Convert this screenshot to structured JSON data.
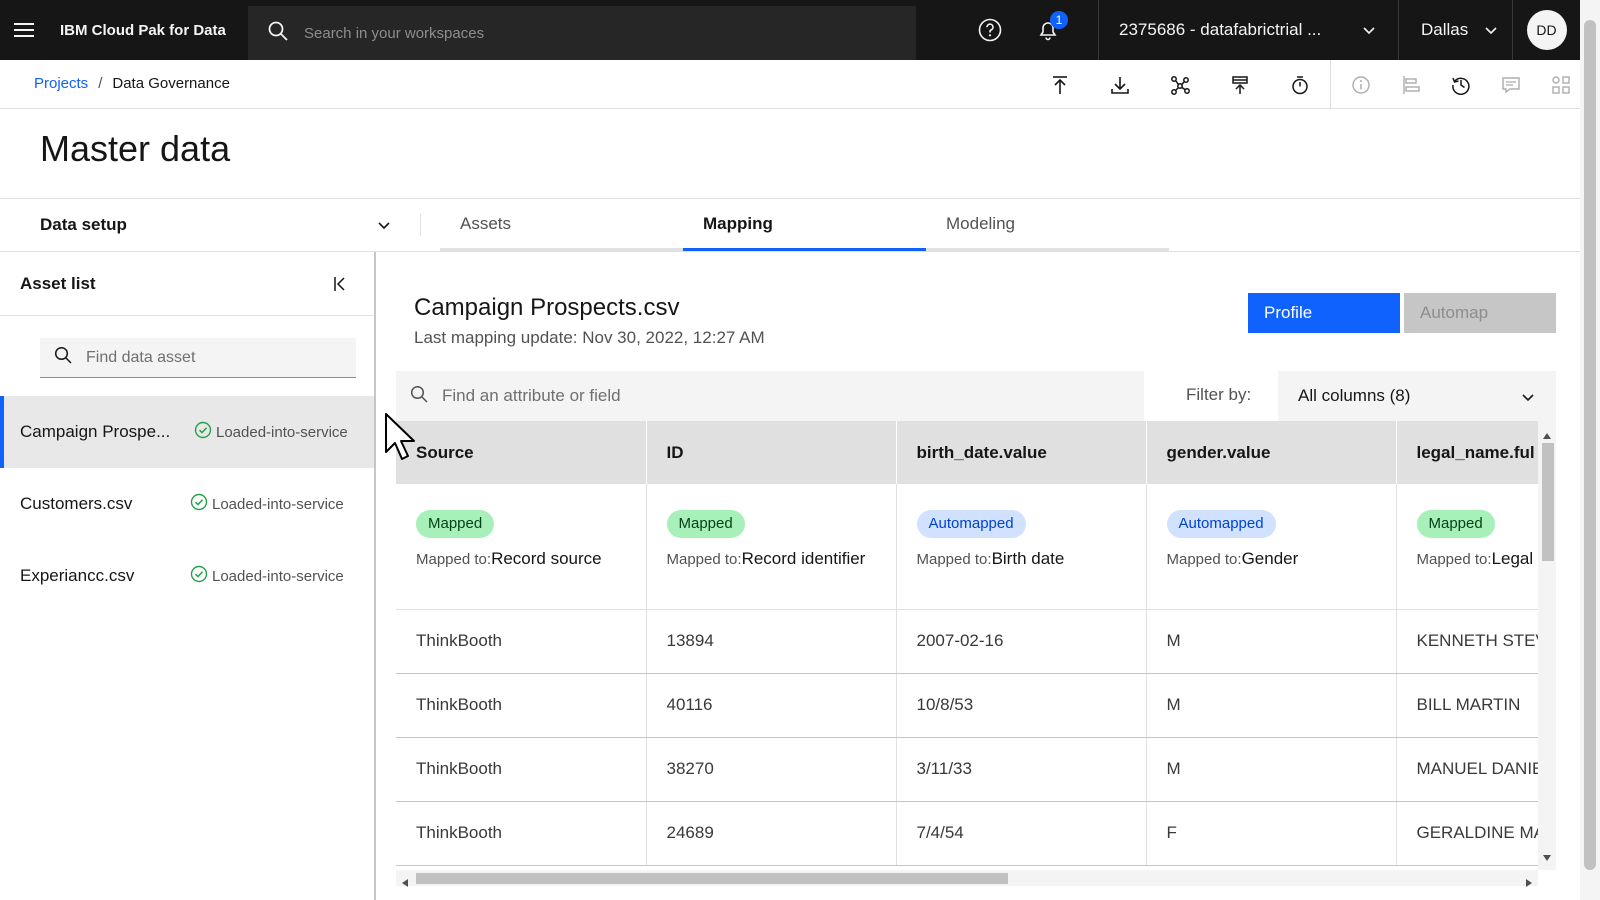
{
  "header": {
    "brand": "IBM Cloud Pak for Data",
    "search_placeholder": "Search in your workspaces",
    "notification_count": "1",
    "account": "2375686 - datafabrictrial ...",
    "region": "Dallas",
    "avatar_initials": "DD",
    "icons": [
      "menu-icon",
      "search-icon",
      "help-icon",
      "notification-icon",
      "chevron-down-icon",
      "avatar"
    ]
  },
  "breadcrumb": {
    "items": [
      {
        "label": "Projects"
      },
      {
        "label": "Data Governance"
      }
    ],
    "separator": "/"
  },
  "toolbar": {
    "icons": [
      "upload-icon",
      "download-icon",
      "graph-icon",
      "publish-icon",
      "timer-icon",
      "info-icon",
      "align-icon",
      "history-icon",
      "comment-icon",
      "apps-icon"
    ]
  },
  "page": {
    "title": "Master data"
  },
  "setup": {
    "label": "Data setup"
  },
  "tabs": [
    {
      "label": "Assets",
      "active": false
    },
    {
      "label": "Mapping",
      "active": true
    },
    {
      "label": "Modeling",
      "active": false
    }
  ],
  "asset_list": {
    "title": "Asset list",
    "search_placeholder": "Find data asset",
    "items": [
      {
        "name": "Campaign Prospe...",
        "status": "Loaded-into-service",
        "selected": true
      },
      {
        "name": "Customers.csv",
        "status": "Loaded-into-service",
        "selected": false
      },
      {
        "name": "Experiancc.csv",
        "status": "Loaded-into-service",
        "selected": false
      }
    ]
  },
  "mapping": {
    "title": "Campaign Prospects.csv",
    "last_update": "Last mapping update: Nov 30, 2022, 12:27 AM",
    "profile_label": "Profile",
    "automap_label": "Automap",
    "field_search_placeholder": "Find an attribute or field",
    "filter_label": "Filter by:",
    "filter_value": "All columns (8)"
  },
  "table": {
    "mapped_to_prefix": "Mapped to:",
    "columns": [
      {
        "header": "Source",
        "status": "Mapped",
        "kind": "mapped",
        "mapped_to": "Record source"
      },
      {
        "header": "ID",
        "status": "Mapped",
        "kind": "mapped",
        "mapped_to": "Record identifier"
      },
      {
        "header": "birth_date.value",
        "status": "Automapped",
        "kind": "auto",
        "mapped_to": "Birth date"
      },
      {
        "header": "gender.value",
        "status": "Automapped",
        "kind": "auto",
        "mapped_to": "Gender"
      },
      {
        "header": "legal_name.ful",
        "status": "Mapped",
        "kind": "mapped",
        "mapped_to": "Legal Full name"
      }
    ],
    "rows": [
      [
        "ThinkBooth",
        "13894",
        "2007-02-16",
        "M",
        "KENNETH STEV"
      ],
      [
        "ThinkBooth",
        "40116",
        "10/8/53",
        "M",
        "BILL MARTIN"
      ],
      [
        "ThinkBooth",
        "38270",
        "3/11/33",
        "M",
        "MANUEL DANIE"
      ],
      [
        "ThinkBooth",
        "24689",
        "7/4/54",
        "F",
        "GERALDINE MA"
      ]
    ]
  },
  "colors": {
    "accent": "#0f62fe",
    "topbar": "#161616",
    "mapped_tag_bg": "#a7f0ba",
    "auto_tag_bg": "#d0e2ff",
    "status_ok": "#24a148"
  }
}
